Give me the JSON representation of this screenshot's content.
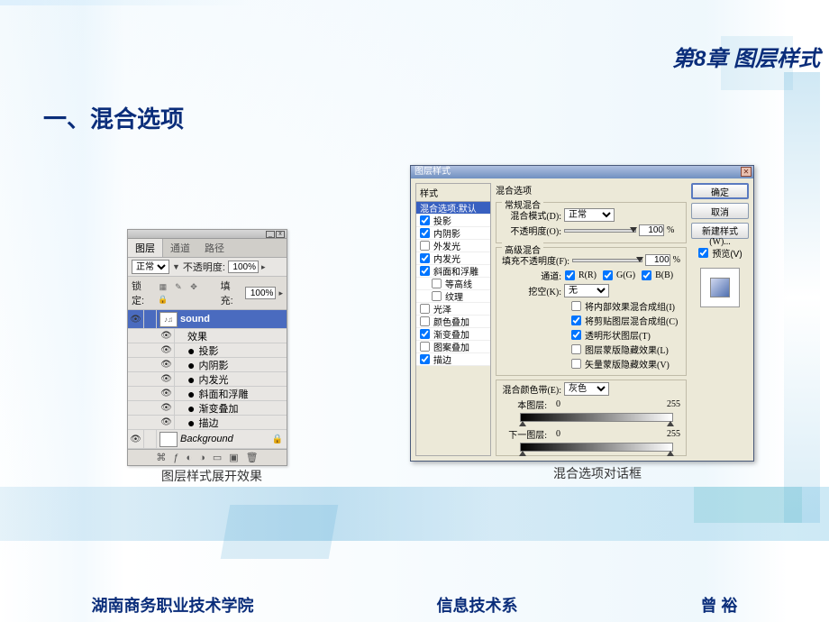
{
  "page": {
    "chapter_header": "第8章 图层样式",
    "section_title": "一、混合选项",
    "caption_layers": "图层样式展开效果",
    "caption_dialog": "混合选项对话框",
    "footer_left": "湖南商务职业技术学院",
    "footer_center": "信息技术系",
    "footer_right": "曾   裕"
  },
  "layers_panel": {
    "tabs": [
      "图层",
      "通道",
      "路径"
    ],
    "active_tab": 0,
    "blend_mode": "正常",
    "opacity_label": "不透明度:",
    "opacity_value": "100%",
    "lock_label": "锁定:",
    "fill_label": "填充:",
    "fill_value": "100%",
    "layer_sound": "sound",
    "fx_label": "效果",
    "fx_items": [
      "投影",
      "内阴影",
      "内发光",
      "斜面和浮雕",
      "渐变叠加",
      "描边"
    ],
    "bg_label": "Background"
  },
  "dialog": {
    "title": "图层样式",
    "styles_header": "样式",
    "style_items": [
      {
        "label": "混合选项:默认",
        "checked": null,
        "selected": true,
        "indent": false
      },
      {
        "label": "投影",
        "checked": true,
        "indent": false
      },
      {
        "label": "内阴影",
        "checked": true,
        "indent": false
      },
      {
        "label": "外发光",
        "checked": false,
        "indent": false
      },
      {
        "label": "内发光",
        "checked": true,
        "indent": false
      },
      {
        "label": "斜面和浮雕",
        "checked": true,
        "indent": false
      },
      {
        "label": "等高线",
        "checked": false,
        "indent": true
      },
      {
        "label": "纹理",
        "checked": false,
        "indent": true
      },
      {
        "label": "光泽",
        "checked": false,
        "indent": false
      },
      {
        "label": "颜色叠加",
        "checked": false,
        "indent": false
      },
      {
        "label": "渐变叠加",
        "checked": true,
        "indent": false
      },
      {
        "label": "图案叠加",
        "checked": false,
        "indent": false
      },
      {
        "label": "描边",
        "checked": true,
        "indent": false
      }
    ],
    "section_main": "混合选项",
    "group_general": "常规混合",
    "blend_mode_label": "混合模式(D):",
    "blend_mode_value": "正常",
    "opacity_label": "不透明度(O):",
    "opacity_value": "100",
    "percent": "%",
    "group_advanced": "高级混合",
    "fill_opacity_label": "填充不透明度(F):",
    "fill_opacity_value": "100",
    "channels_label": "通道:",
    "channel_r": "R(R)",
    "channel_g": "G(G)",
    "channel_b": "B(B)",
    "knockout_label": "挖空(K):",
    "knockout_value": "无",
    "adv_checks": [
      {
        "label": "将内部效果混合成组(I)",
        "checked": false
      },
      {
        "label": "将剪贴图层混合成组(C)",
        "checked": true
      },
      {
        "label": "透明形状图层(T)",
        "checked": true
      },
      {
        "label": "图层蒙版隐藏效果(L)",
        "checked": false
      },
      {
        "label": "矢量蒙版隐藏效果(V)",
        "checked": false
      }
    ],
    "blendif_label": "混合颜色带(E):",
    "blendif_value": "灰色",
    "this_layer_label": "本图层:",
    "this_layer_lo": "0",
    "this_layer_hi": "255",
    "under_layer_label": "下一图层:",
    "under_layer_lo": "0",
    "under_layer_hi": "255",
    "btn_ok": "确定",
    "btn_cancel": "取消",
    "btn_newstyle": "新建样式(W)...",
    "preview_label": "预览(V)"
  }
}
